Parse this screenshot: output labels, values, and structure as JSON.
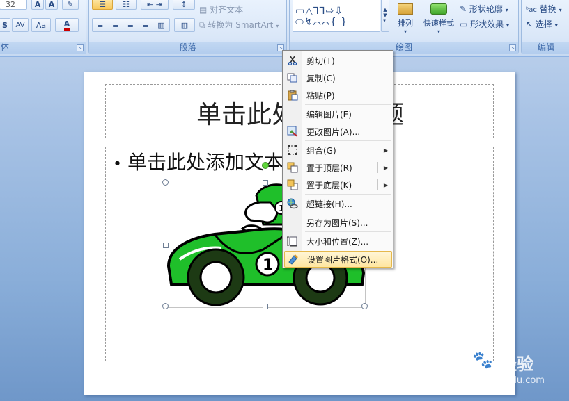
{
  "ribbon": {
    "font_group": {
      "label": "体",
      "size_value": "32",
      "buttons": [
        "S",
        "AV",
        "Aa",
        "A"
      ]
    },
    "paragraph_group": {
      "label": "段落",
      "align_text": "对齐文本",
      "smartart": "转换为 SmartArt"
    },
    "drawing_group": {
      "label": "绘图",
      "arrange": "排列",
      "quick_styles": "快速样式",
      "shape_outline": "形状轮廓",
      "shape_effects": "形状效果"
    },
    "editing_group": {
      "label": "编辑",
      "replace": "替换",
      "select": "选择"
    }
  },
  "slide": {
    "title": "单击此处添加标题",
    "title_visible_left": "单击此处",
    "title_visible_right": "题",
    "body_bullet": "•",
    "body_text": "单击此处添加文本"
  },
  "context_menu": {
    "items": [
      {
        "label": "剪切(T)",
        "icon": "cut-icon"
      },
      {
        "label": "复制(C)",
        "icon": "copy-icon"
      },
      {
        "label": "粘贴(P)",
        "icon": "paste-icon"
      },
      {
        "label": "编辑图片(E)",
        "icon": ""
      },
      {
        "label": "更改图片(A)...",
        "icon": "change-picture-icon"
      },
      {
        "label": "组合(G)",
        "icon": "group-icon",
        "submenu": true
      },
      {
        "label": "置于顶层(R)",
        "icon": "bring-to-front-icon",
        "submenu": true
      },
      {
        "label": "置于底层(K)",
        "icon": "send-to-back-icon",
        "submenu": true
      },
      {
        "label": "超链接(H)...",
        "icon": "hyperlink-icon"
      },
      {
        "label": "另存为图片(S)...",
        "icon": ""
      },
      {
        "label": "大小和位置(Z)...",
        "icon": "size-position-icon"
      },
      {
        "label": "设置图片格式(O)...",
        "icon": "format-picture-icon",
        "highlighted": true
      }
    ]
  },
  "watermark": {
    "logo": "Bai",
    "logo_suffix": "经验",
    "url": "jingyan.baidu.com"
  },
  "colors": {
    "car_green": "#1fbf2a",
    "car_dark": "#1d3a14",
    "menu_highlight": "#ffe6a0"
  }
}
